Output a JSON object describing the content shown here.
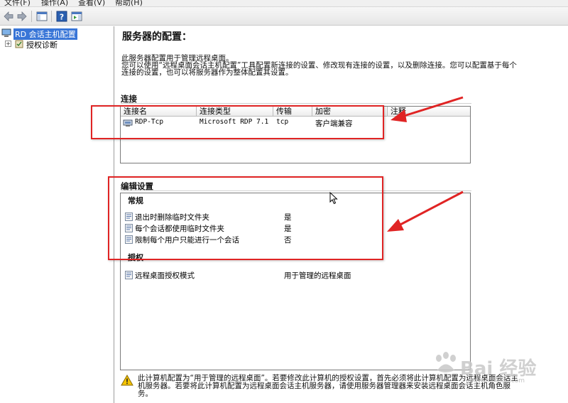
{
  "menu": [
    "文件(F)",
    "操作(A)",
    "查看(V)",
    "帮助(H)"
  ],
  "toolbar": {
    "icons": [
      "back-icon",
      "forward-icon",
      "console-tree-icon",
      "help-icon",
      "action-pane-icon"
    ]
  },
  "tree": {
    "root_label": "RD 会话主机配置",
    "child_label": "授权诊断"
  },
  "main": {
    "title": "服务器的配置：",
    "description": "此服务器配置用于管理远程桌面。\n您可以使用“远程桌面会话主机配置”工具配置新连接的设置、修改现有连接的设置，以及删除连接。您可以配置基于每个连接的设置，也可以将服务器作为整体配置其设置。"
  },
  "connections": {
    "heading": "连接",
    "columns": [
      "连接名",
      "连接类型",
      "传输",
      "加密",
      "注释"
    ],
    "rows": [
      {
        "name": "RDP-Tcp",
        "type": "Microsoft RDP 7.1",
        "transport": "tcp",
        "encryption": "客户端兼容",
        "comment": ""
      }
    ]
  },
  "settings": {
    "heading": "编辑设置",
    "general_heading": "常规",
    "general": [
      {
        "name": "退出时删除临时文件夹",
        "value": "是"
      },
      {
        "name": "每个会话都使用临时文件夹",
        "value": "是"
      },
      {
        "name": "限制每个用户只能进行一个会话",
        "value": "否"
      }
    ],
    "licensing_heading": "授权",
    "licensing": [
      {
        "name": "远程桌面授权模式",
        "value": "用于管理的远程桌面"
      }
    ]
  },
  "warning": {
    "text": "此计算机配置为“用于管理的远程桌面”。若要修改此计算机的授权设置，首先必须将此计算机配置为远程桌面会话主机服务器。若要将此计算机配置为远程桌面会话主机服务器，请使用服务器管理器来安装远程桌面会话主机角色服务。"
  },
  "watermark": {
    "text": "Bai 经验",
    "sub": "jingyan.baidu.com"
  },
  "colors": {
    "annotation_red": "#e02424",
    "selection_blue": "#3875d7"
  }
}
